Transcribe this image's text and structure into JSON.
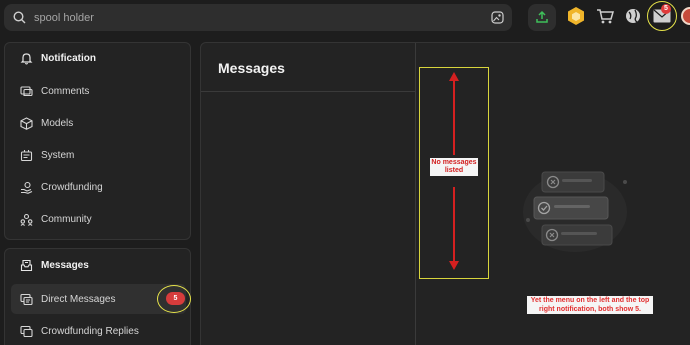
{
  "search": {
    "placeholder": "spool holder",
    "value": ""
  },
  "topbar": {
    "mail_badge": "5",
    "icons": [
      "upload-icon",
      "hexagon-gift-icon",
      "cart-icon",
      "globe-icon",
      "mail-icon",
      "avatar"
    ]
  },
  "sidebar": {
    "notification_header": "Notification",
    "notification_items": [
      {
        "label": "Comments",
        "icon": "comments-icon"
      },
      {
        "label": "Models",
        "icon": "cube-icon"
      },
      {
        "label": "System",
        "icon": "system-icon"
      },
      {
        "label": "Crowdfunding",
        "icon": "crowdfunding-icon"
      },
      {
        "label": "Community",
        "icon": "community-icon"
      }
    ],
    "messages_header": "Messages",
    "messages_items": [
      {
        "label": "Direct Messages",
        "badge": "5",
        "icon": "direct-messages-icon",
        "active": true
      },
      {
        "label": "Crowdfunding Replies",
        "icon": "crowdfunding-replies-icon"
      }
    ]
  },
  "main": {
    "title": "Messages"
  },
  "annotations": {
    "no_messages": "No messages listed",
    "note": "Yet the menu on the left and the top right notification, both show 5."
  },
  "colors": {
    "highlight": "#e5e24a",
    "badge": "#d63c3c",
    "annotation_text": "#d22020",
    "upload_green": "#3fbf5a",
    "gift_yellow": "#f0b52a"
  }
}
